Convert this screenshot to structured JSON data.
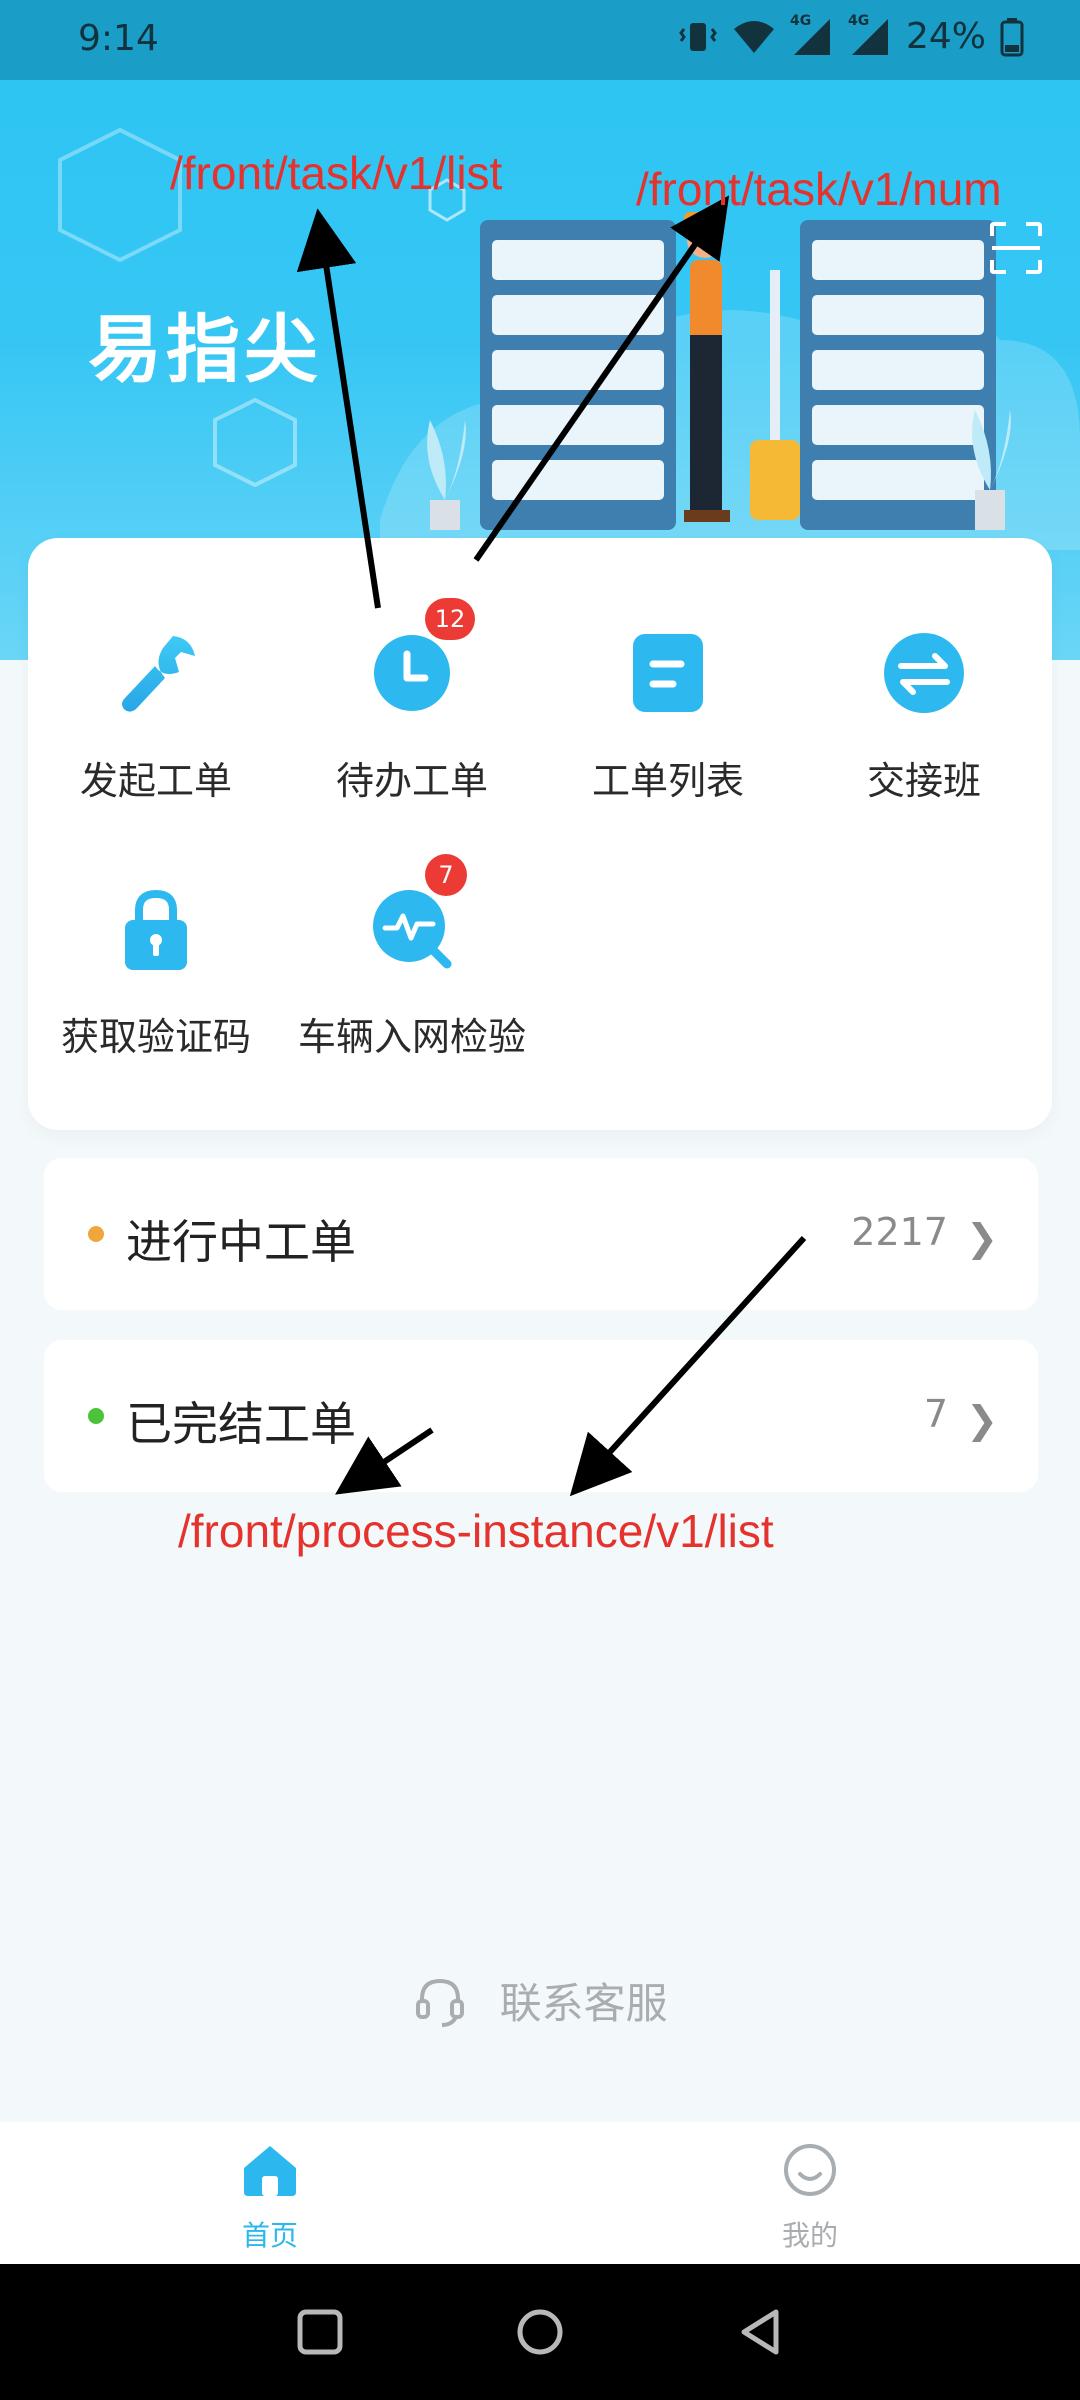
{
  "status_bar": {
    "time": "9:14",
    "battery": "24%",
    "network_labels": [
      "4G",
      "4G"
    ],
    "icons": [
      "vibrate-icon",
      "wifi-icon",
      "signal-icon",
      "signal-icon",
      "battery-icon"
    ]
  },
  "header": {
    "app_title": "易指尖",
    "scan_icon": "scan-icon"
  },
  "annotations": {
    "task_list": "/front/task/v1/list",
    "task_num": "/front/task/v1/num",
    "process_list": "/front/process-instance/v1/list"
  },
  "menu": {
    "items": [
      {
        "label": "发起工单",
        "icon": "wrench-icon"
      },
      {
        "label": "待办工单",
        "icon": "clock-icon",
        "badge": "12"
      },
      {
        "label": "工单列表",
        "icon": "list-icon"
      },
      {
        "label": "交接班",
        "icon": "swap-icon"
      },
      {
        "label": "获取验证码",
        "icon": "lock-icon"
      },
      {
        "label": "车辆入网检验",
        "icon": "inspect-icon",
        "badge": "7"
      }
    ]
  },
  "orders": [
    {
      "label": "进行中工单",
      "count": "2217",
      "dot_color": "#f0a63c"
    },
    {
      "label": "已完结工单",
      "count": "7",
      "dot_color": "#4cc23b"
    }
  ],
  "support": {
    "label": "联系客服"
  },
  "bottom_nav": {
    "home_label": "首页",
    "mine_label": "我的"
  },
  "colors": {
    "accent": "#2cb8ee",
    "badge": "#ec3b35",
    "annotation": "#e5322d"
  }
}
